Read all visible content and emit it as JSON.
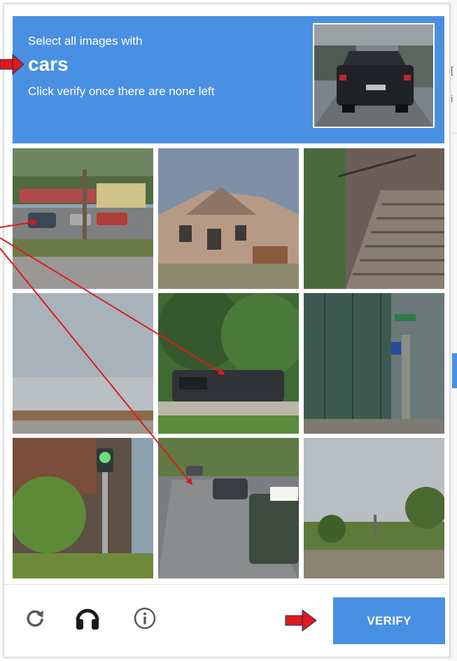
{
  "challenge": {
    "instruction": "Select all images with",
    "target_word": "cars",
    "subtext": "Click verify once there are none left"
  },
  "tiles": [
    {
      "scene": "gas station and parked cars",
      "selected": false
    },
    {
      "scene": "brick house",
      "selected": false
    },
    {
      "scene": "outdoor stairs",
      "selected": false
    },
    {
      "scene": "sky and rooftop",
      "selected": false
    },
    {
      "scene": "tree over parked car",
      "selected": false
    },
    {
      "scene": "building with street sign",
      "selected": false
    },
    {
      "scene": "traffic light and bushes",
      "selected": false
    },
    {
      "scene": "street with parked cars",
      "selected": false
    },
    {
      "scene": "road and trees",
      "selected": false
    }
  ],
  "footer": {
    "reload_icon": "reload-icon",
    "audio_icon": "headphones-icon",
    "info_icon": "info-icon",
    "verify_label": "VERIFY"
  },
  "colors": {
    "accent": "#4a90e2",
    "annotation": "#e0191b"
  }
}
